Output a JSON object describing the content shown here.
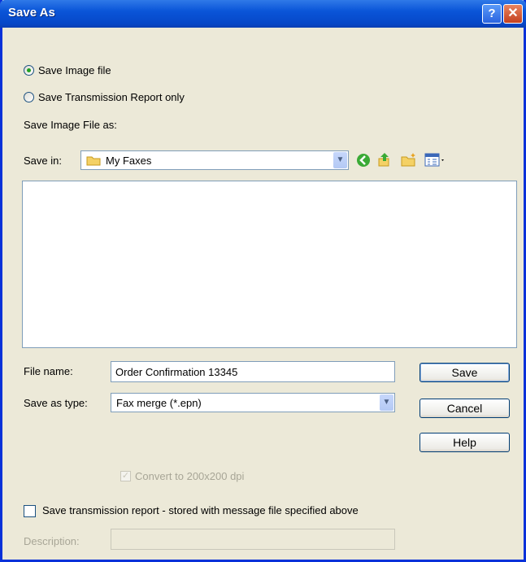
{
  "window": {
    "title": "Save As",
    "help_glyph": "?",
    "close_glyph": "✕"
  },
  "mode": {
    "option_image": "Save Image file",
    "option_report": "Save Transmission Report only",
    "selected": "Save Image file"
  },
  "section_label": "Save Image File as:",
  "save_in": {
    "label": "Save in:",
    "value": "My Faxes"
  },
  "toolbar": {
    "icons": [
      "back-icon",
      "up-folder-icon",
      "new-folder-icon",
      "views-menu-icon"
    ]
  },
  "file_name": {
    "label": "File name:",
    "value": "Order Confirmation 13345"
  },
  "save_as_type": {
    "label": "Save as type:",
    "value": "Fax merge (*.epn)"
  },
  "buttons": {
    "save": "Save",
    "cancel": "Cancel",
    "help": "Help"
  },
  "convert": {
    "label": "Convert to 200x200 dpi",
    "checked": true,
    "enabled": false
  },
  "report_checkbox": {
    "label": "Save transmission report - stored with message file specified above",
    "checked": false
  },
  "description": {
    "label": "Description:",
    "value": "",
    "enabled": false
  },
  "colors": {
    "title_bar": "#0a55d8",
    "dialog_bg": "#ece9d8",
    "accent_green": "#21a121",
    "close_red": "#c4401f"
  }
}
